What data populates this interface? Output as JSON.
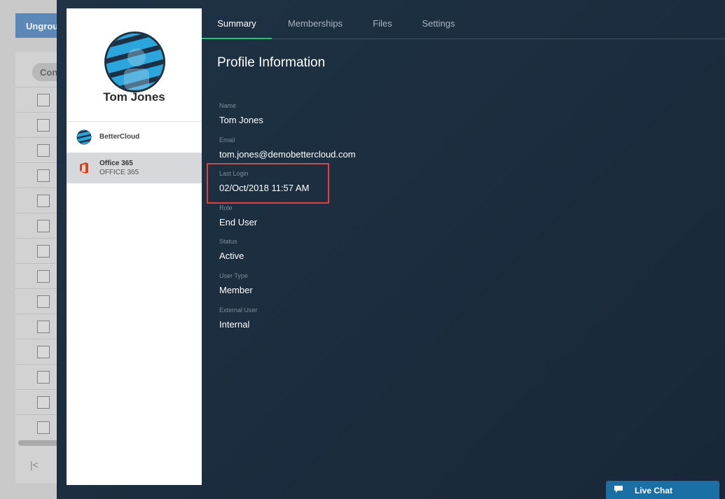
{
  "background": {
    "ungroup_label": "Ungroup",
    "pill_label": "Con",
    "pager_first": "|<"
  },
  "profile": {
    "name": "Tom Jones",
    "apps": [
      {
        "name": "BetterCloud",
        "sub": ""
      },
      {
        "name": "Office 365",
        "sub": "OFFICE 365"
      }
    ]
  },
  "tabs": [
    "Summary",
    "Memberships",
    "Files",
    "Settings"
  ],
  "section_title": "Profile Information",
  "fields": [
    {
      "label": "Name",
      "value": "Tom Jones"
    },
    {
      "label": "Email",
      "value": "tom.jones@demobettercloud.com"
    },
    {
      "label": "Last Login",
      "value": "02/Oct/2018 11:57 AM"
    },
    {
      "label": "Role",
      "value": "End User"
    },
    {
      "label": "Status",
      "value": "Active"
    },
    {
      "label": "User Type",
      "value": "Member"
    },
    {
      "label": "External User",
      "value": "Internal"
    }
  ],
  "live_chat": {
    "label": "Live Chat"
  },
  "colors": {
    "accent_tab": "#3db37a",
    "highlight": "#e2403f",
    "office_red": "#e2401c",
    "chat_blue": "#1a6fa5"
  }
}
